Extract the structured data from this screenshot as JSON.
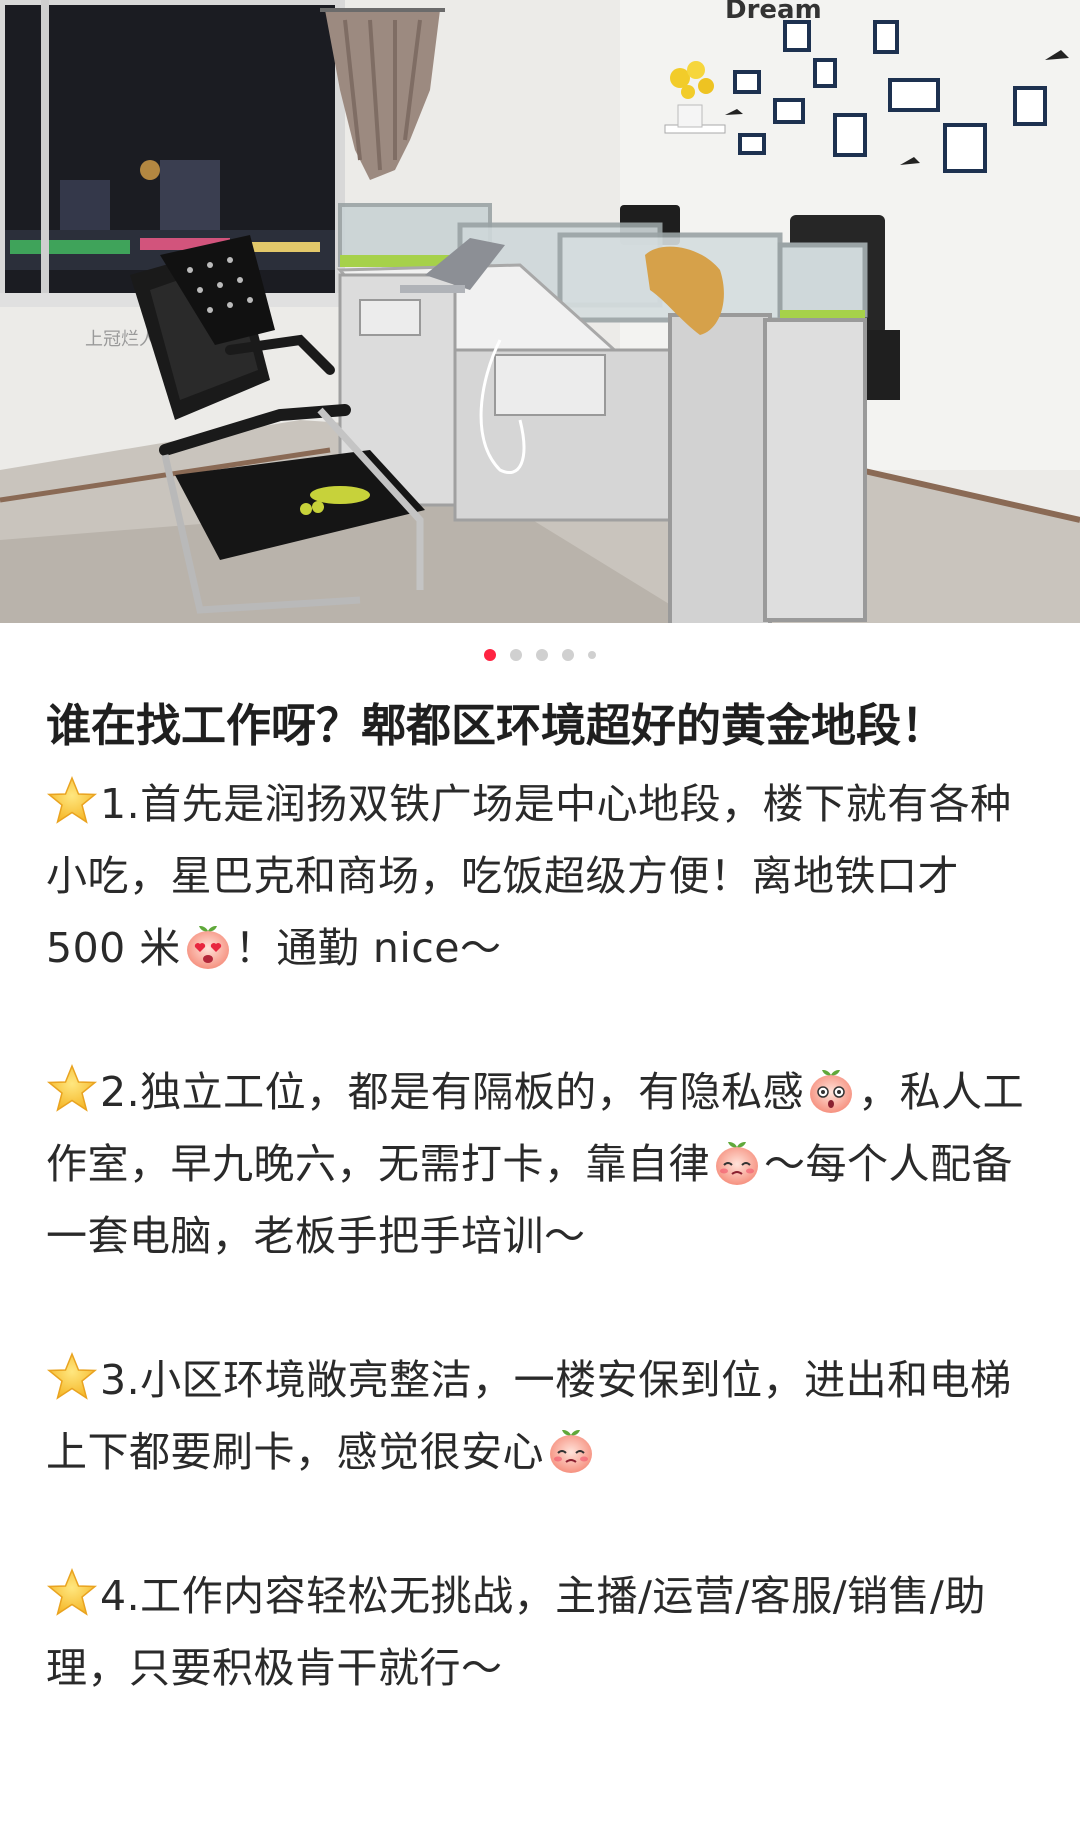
{
  "photo": {
    "wall_sign_text": "Dream",
    "window_sign_text": "上冠烂人",
    "carousel": {
      "total": 5,
      "active_index": 0
    }
  },
  "post": {
    "title": "谁在找工作呀？郫都区环境超好的黄金地段！",
    "paragraphs": [
      {
        "icon": "star-emoji-icon",
        "segments": [
          {
            "type": "text",
            "value": "1.首先是润扬双铁广场是中心地段，楼下就有各种小吃，星巴克和商场，吃饭超级方便！离地铁口才 500 米"
          },
          {
            "type": "emoji",
            "name": "heart-eyes-peach-emoji-icon"
          },
          {
            "type": "text",
            "value": "！通勤 nice～"
          }
        ]
      },
      {
        "icon": "star-emoji-icon",
        "segments": [
          {
            "type": "text",
            "value": "2.独立工位，都是有隔板的，有隐私感"
          },
          {
            "type": "emoji",
            "name": "surprised-peach-emoji-icon"
          },
          {
            "type": "text",
            "value": "，私人工作室，早九晚六，无需打卡，靠自律"
          },
          {
            "type": "emoji",
            "name": "shy-peach-emoji-icon"
          },
          {
            "type": "text",
            "value": "～每个人配备一套电脑，老板手把手培训～"
          }
        ]
      },
      {
        "icon": "star-emoji-icon",
        "segments": [
          {
            "type": "text",
            "value": "3.小区环境敞亮整洁，一楼安保到位，进出和电梯上下都要刷卡，感觉很安心"
          },
          {
            "type": "emoji",
            "name": "shy-peach-emoji-icon"
          }
        ]
      },
      {
        "icon": "star-emoji-icon",
        "segments": [
          {
            "type": "text",
            "value": "4.工作内容轻松无挑战，主播/运营/客服/销售/助理，只要积极肯干就行～"
          }
        ]
      }
    ]
  },
  "colors": {
    "accent": "#ff2442",
    "dot_inactive": "#d0d0d0",
    "text": "#2a2a2a",
    "partition_green": "#a6d14a"
  }
}
